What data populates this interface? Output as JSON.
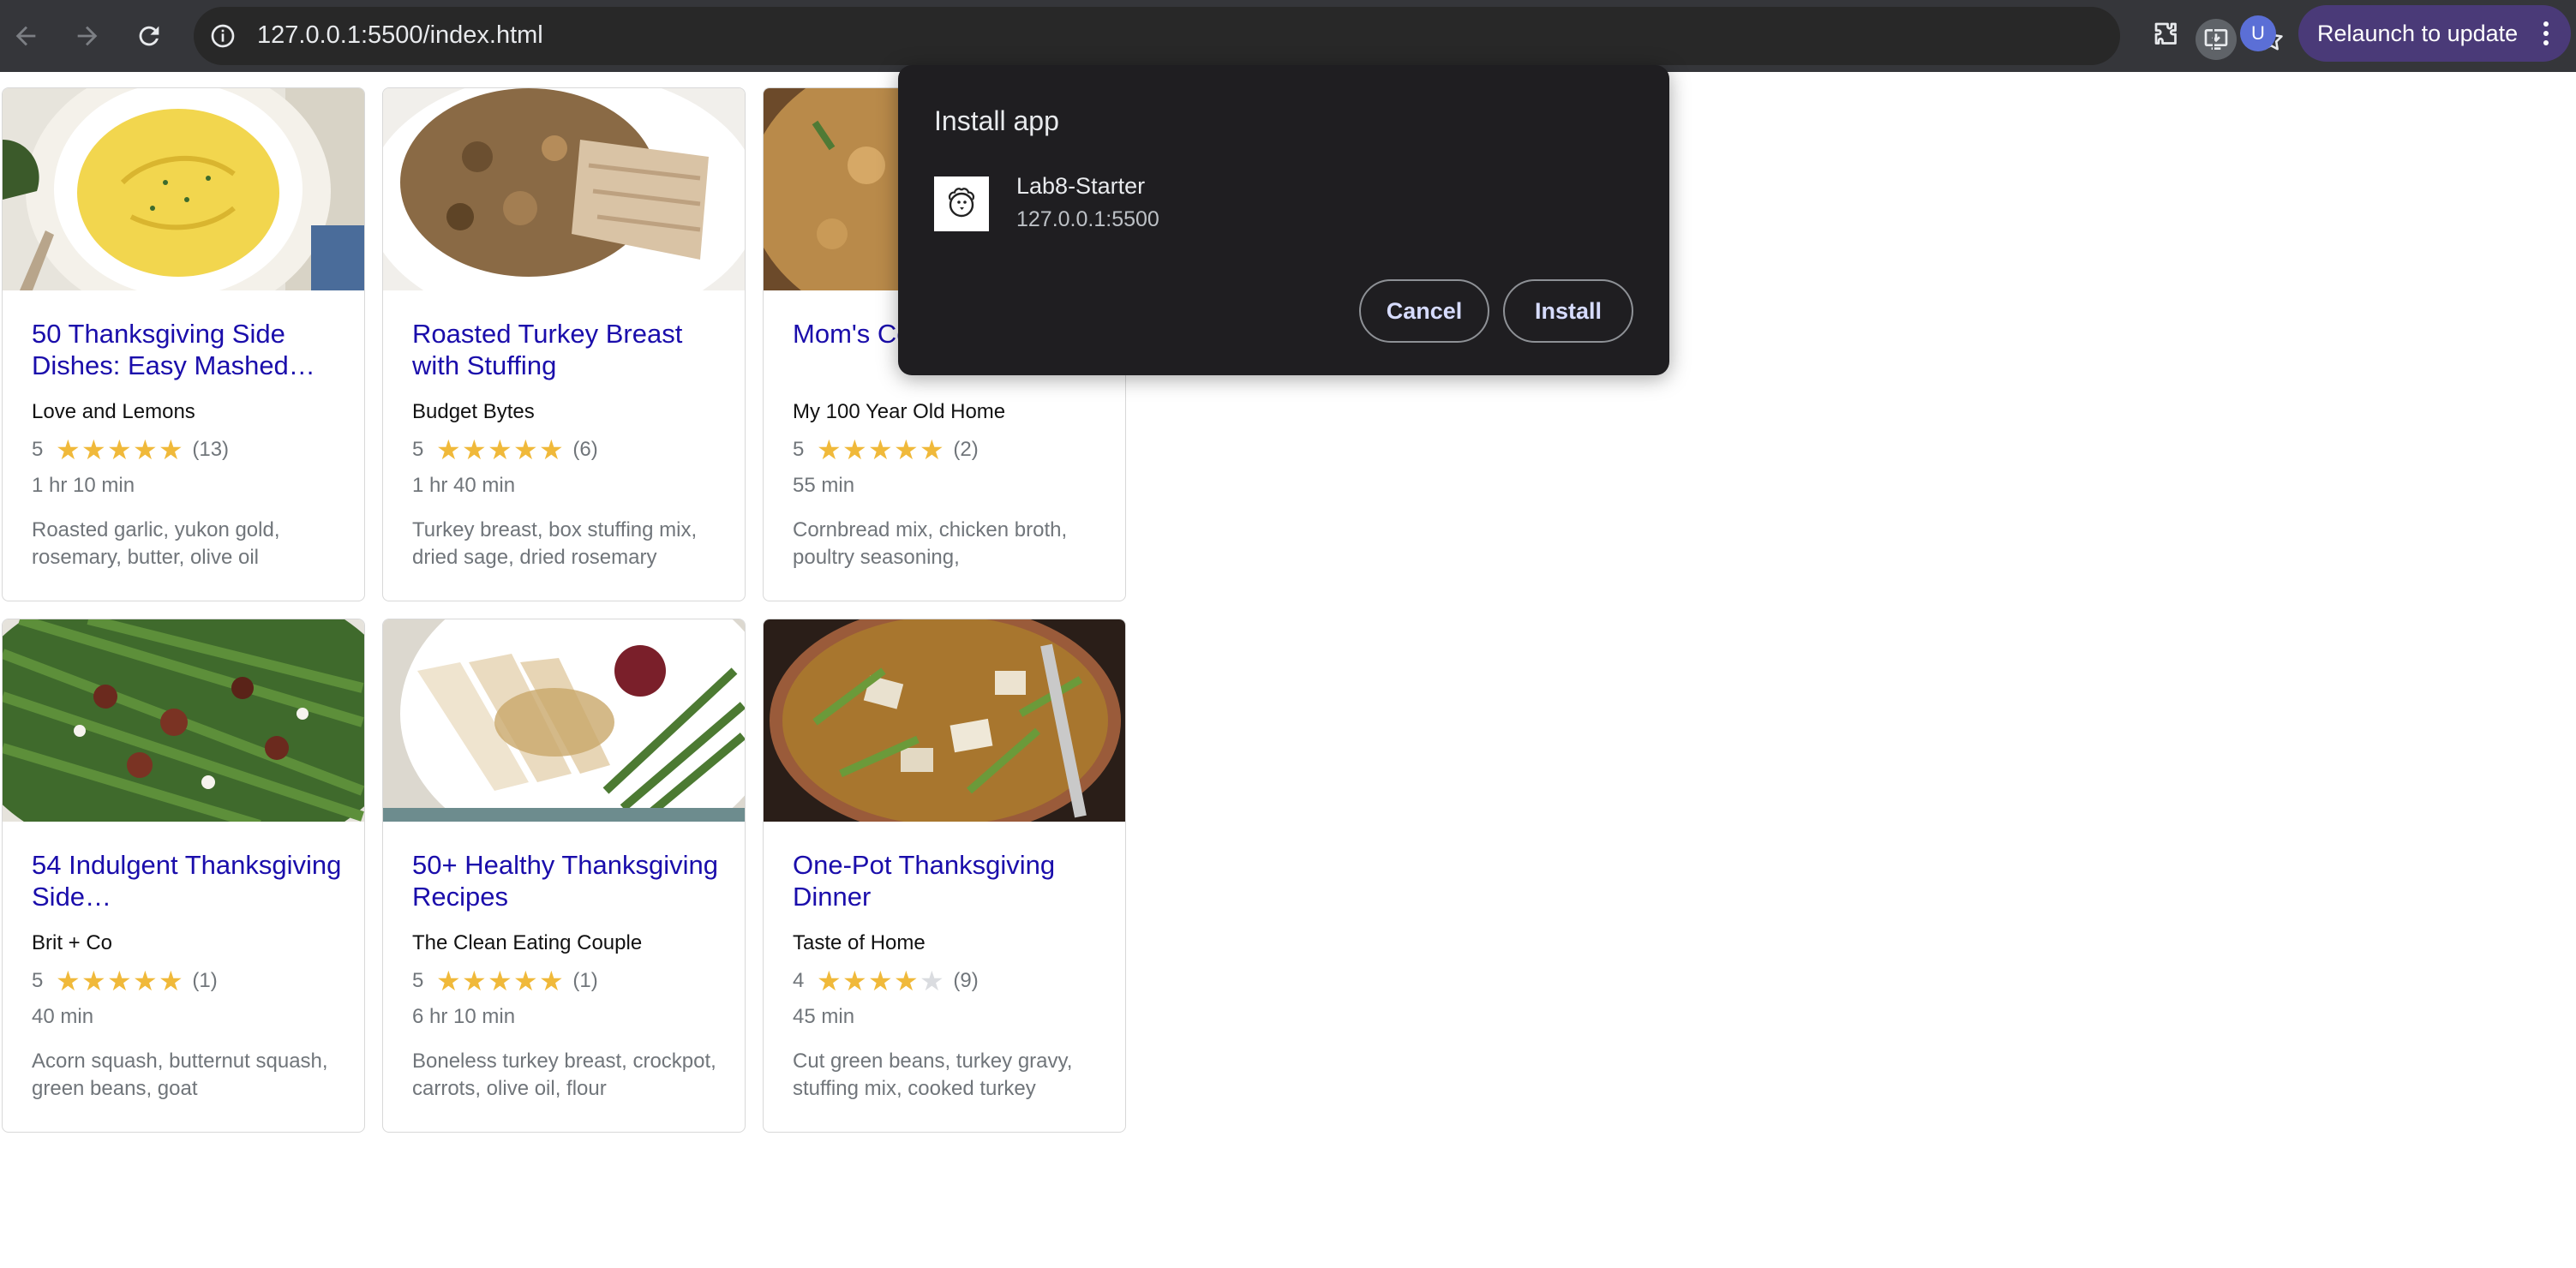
{
  "browser": {
    "url": "127.0.0.1:5500/index.html",
    "relaunch_label": "Relaunch to update",
    "avatar_initial": "U"
  },
  "recipes": [
    {
      "title": "50 Thanksgiving Side Dishes: Easy Mashed…",
      "org": "Love and Lemons",
      "rating": "5",
      "stars": 5,
      "count": "(13)",
      "time": "1 hr 10 min",
      "ingredients": "Roasted garlic, yukon gold, rosemary, butter, olive oil",
      "image": "mashed-potatoes"
    },
    {
      "title": "Roasted Turkey Breast with Stuffing",
      "org": "Budget Bytes",
      "rating": "5",
      "stars": 5,
      "count": "(6)",
      "time": "1 hr 40 min",
      "ingredients": "Turkey breast, box stuffing mix, dried sage, dried rosemary",
      "image": "turkey-stuffing"
    },
    {
      "title": "Mom's Cornbread Stuffing",
      "org": "My 100 Year Old Home",
      "rating": "5",
      "stars": 5,
      "count": "(2)",
      "time": "55 min",
      "ingredients": "Cornbread mix, chicken broth, poultry seasoning,",
      "image": "cornbread-stuffing"
    },
    {
      "title": "54 Indulgent Thanksgiving Side…",
      "org": "Brit + Co",
      "rating": "5",
      "stars": 5,
      "count": "(1)",
      "time": "40 min",
      "ingredients": "Acorn squash, butternut squash, green beans, goat",
      "image": "green-beans"
    },
    {
      "title": "50+ Healthy Thanksgiving Recipes",
      "org": "The Clean Eating Couple",
      "rating": "5",
      "stars": 5,
      "count": "(1)",
      "time": "6 hr 10 min",
      "ingredients": "Boneless turkey breast, crockpot, carrots, olive oil, flour",
      "image": "turkey-plate"
    },
    {
      "title": "One-Pot Thanksgiving Dinner",
      "org": "Taste of Home",
      "rating": "4",
      "stars": 4,
      "count": "(9)",
      "time": "45 min",
      "ingredients": "Cut green beans, turkey gravy, stuffing mix, cooked turkey",
      "image": "one-pot-dinner"
    }
  ],
  "install_dialog": {
    "title": "Install app",
    "app_name": "Lab8-Starter",
    "app_url": "127.0.0.1:5500",
    "cancel_label": "Cancel",
    "install_label": "Install"
  },
  "colors": {
    "toolbar": "#35363a",
    "link": "#1a0dab",
    "star": "#f0b93a",
    "dialog_bg": "#1f1e21",
    "dialog_button_text": "#d7dcff"
  }
}
